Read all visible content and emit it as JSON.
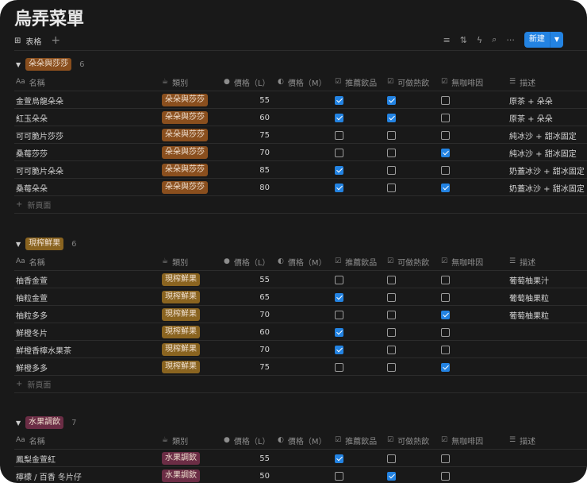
{
  "title": "烏弄菜單",
  "view": {
    "tab_label": "表格",
    "new_label": "新建"
  },
  "columns": {
    "name": "名稱",
    "type": "類別",
    "price_l": "價格（L）",
    "price_m": "價格（M）",
    "recommended": "推薦飲品",
    "hot": "可做熱飲",
    "no_caffeine": "無咖啡因",
    "desc": "描述",
    "name_prefix": "Aa"
  },
  "new_page": "新頁面",
  "colors": {
    "accent": "#2383e2",
    "tag1": "#8a4f1e",
    "tag2": "#8a6420",
    "tag3": "#6b2d45"
  },
  "groups": [
    {
      "label": "朵朵與莎莎",
      "count": "6",
      "rows": [
        {
          "name": "金萱烏龍朵朵",
          "type": "朵朵與莎莎",
          "pl": "55",
          "rec": true,
          "hot": true,
          "nc": false,
          "desc": "原茶 + 朵朵"
        },
        {
          "name": "紅玉朵朵",
          "type": "朵朵與莎莎",
          "pl": "60",
          "rec": true,
          "hot": true,
          "nc": false,
          "desc": "原茶 + 朵朵"
        },
        {
          "name": "可可脆片莎莎",
          "type": "朵朵與莎莎",
          "pl": "75",
          "rec": false,
          "hot": false,
          "nc": false,
          "desc": "純冰沙 + 甜冰固定"
        },
        {
          "name": "桑莓莎莎",
          "type": "朵朵與莎莎",
          "pl": "70",
          "rec": false,
          "hot": false,
          "nc": true,
          "desc": "純冰沙 + 甜冰固定"
        },
        {
          "name": "可可脆片朵朵",
          "type": "朵朵與莎莎",
          "pl": "85",
          "rec": true,
          "hot": false,
          "nc": false,
          "desc": "奶蓋冰沙 + 甜冰固定"
        },
        {
          "name": "桑莓朵朵",
          "type": "朵朵與莎莎",
          "pl": "80",
          "rec": true,
          "hot": false,
          "nc": true,
          "desc": "奶蓋冰沙 + 甜冰固定"
        }
      ]
    },
    {
      "label": "現榨鮮果",
      "count": "6",
      "rows": [
        {
          "name": "柚香金萱",
          "type": "現榨鮮果",
          "pl": "55",
          "rec": false,
          "hot": false,
          "nc": false,
          "desc": "葡萄柚果汁"
        },
        {
          "name": "柚粒金萱",
          "type": "現榨鮮果",
          "pl": "65",
          "rec": true,
          "hot": false,
          "nc": false,
          "desc": "葡萄柚果粒"
        },
        {
          "name": "柚粒多多",
          "type": "現榨鮮果",
          "pl": "70",
          "rec": false,
          "hot": false,
          "nc": true,
          "desc": "葡萄柚果粒"
        },
        {
          "name": "鮮橙冬片",
          "type": "現榨鮮果",
          "pl": "60",
          "rec": true,
          "hot": false,
          "nc": false,
          "desc": ""
        },
        {
          "name": "鮮橙香檸水果茶",
          "type": "現榨鮮果",
          "pl": "70",
          "rec": true,
          "hot": false,
          "nc": false,
          "desc": ""
        },
        {
          "name": "鮮橙多多",
          "type": "現榨鮮果",
          "pl": "75",
          "rec": false,
          "hot": false,
          "nc": true,
          "desc": ""
        }
      ]
    },
    {
      "label": "水果調飲",
      "count": "7",
      "rows": [
        {
          "name": "鳳梨金萱紅",
          "type": "水果調飲",
          "pl": "55",
          "rec": true,
          "hot": false,
          "nc": false,
          "desc": ""
        },
        {
          "name": "檸檬 / 百香 冬片仔",
          "type": "水果調飲",
          "pl": "50",
          "rec": false,
          "hot": true,
          "nc": false,
          "desc": ""
        }
      ]
    }
  ]
}
